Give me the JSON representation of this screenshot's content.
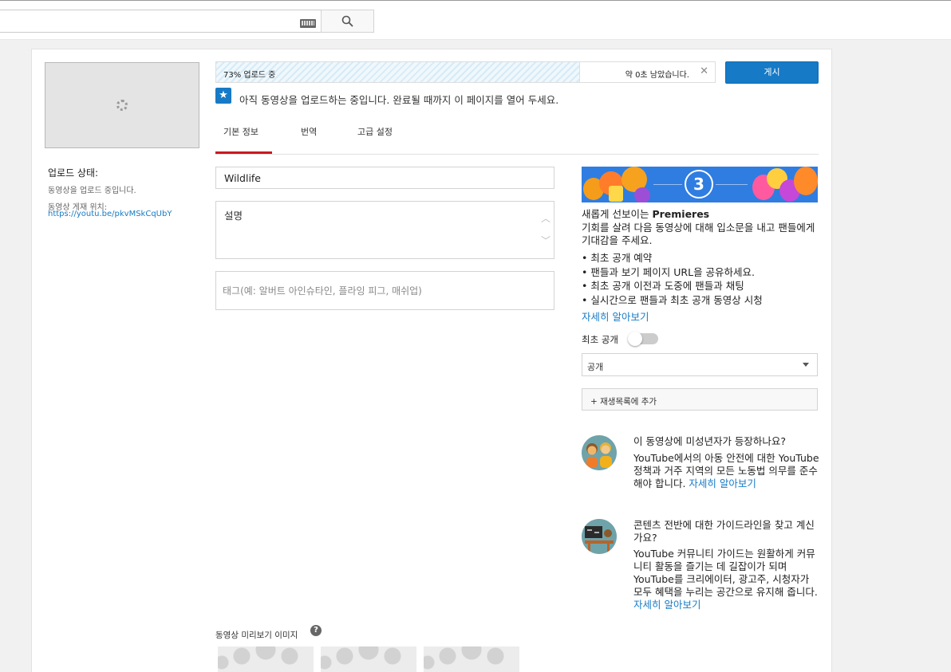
{
  "upload": {
    "progress_label": "73% 업로드 중",
    "progress_fraction": 0.73,
    "remaining": "약 0초 남았습니다.",
    "publish_label": "게시",
    "notice": "아직 동영상을 업로드하는 중입니다. 완료될 때까지 이 페이지를 열어 두세요."
  },
  "status": {
    "title": "업로드 상태:",
    "text": "동영상을 업로드 중입니다.",
    "url_label": "동영상 게재 위치:",
    "url": "https://youtu.be/pkvMSkCqUbY"
  },
  "tabs": [
    {
      "label": "기본 정보",
      "active": true
    },
    {
      "label": "번역",
      "active": false
    },
    {
      "label": "고급 설정",
      "active": false
    }
  ],
  "form": {
    "title_value": "Wildlife",
    "description_placeholder": "설명",
    "tags_placeholder": "태그(예: 알버트 아인슈타인, 플라잉 피그, 매쉬업)",
    "thumbnails_label": "동영상 미리보기 이미지",
    "help_glyph": "?"
  },
  "premieres": {
    "banner_number": "3",
    "title_prefix": "새롭게 선보이는 ",
    "title_bold": "Premieres",
    "body": "기회를 살려 다음 동영상에 대해 입소문을 내고 팬들에게 기대감을 주세요.",
    "bullets": [
      "• 최초 공개 예약",
      "• 팬들과 보기 페이지 URL을 공유하세요.",
      "• 최초 공개 이전과 도중에 팬들과 채팅",
      "• 실시간으로 팬들과 최초 공개 동영상 시청"
    ],
    "learn_more": "자세히 알아보기",
    "toggle_label": "최초 공개",
    "toggle_on": false
  },
  "visibility": {
    "selected": "공개"
  },
  "playlist": {
    "label": "+ 재생목록에 추가"
  },
  "child_safety": {
    "title": "이 동영상에 미성년자가 등장하나요?",
    "body": "YouTube에서의 아동 안전에 대한 YouTube 정책과 거주 지역의 모든 노동법 의무를 준수해야 합니다. ",
    "link": "자세히 알아보기"
  },
  "guidelines": {
    "title": "콘텐츠 전반에 대한 가이드라인을 찾고 계신가요?",
    "body": "YouTube 커뮤니티 가이드는 원활하게 커뮤니티 활동을 즐기는 데 길잡이가 되며 YouTube를 크리에이터, 광고주, 시청자가 모두 혜택을 누리는 공간으로 유지해 줍니다. ",
    "link": "자세히 알아보기"
  },
  "colors": {
    "accent": "#167ac6",
    "active_tab": "#cc181e",
    "progress_stripe": "#d5ebf7"
  },
  "icons": {
    "search": "search-icon",
    "keyboard": "keyboard-icon",
    "close": "close-icon",
    "star": "star-icon",
    "spinner": "spinner-icon",
    "help": "help-icon",
    "caret": "chevron-down-icon"
  }
}
